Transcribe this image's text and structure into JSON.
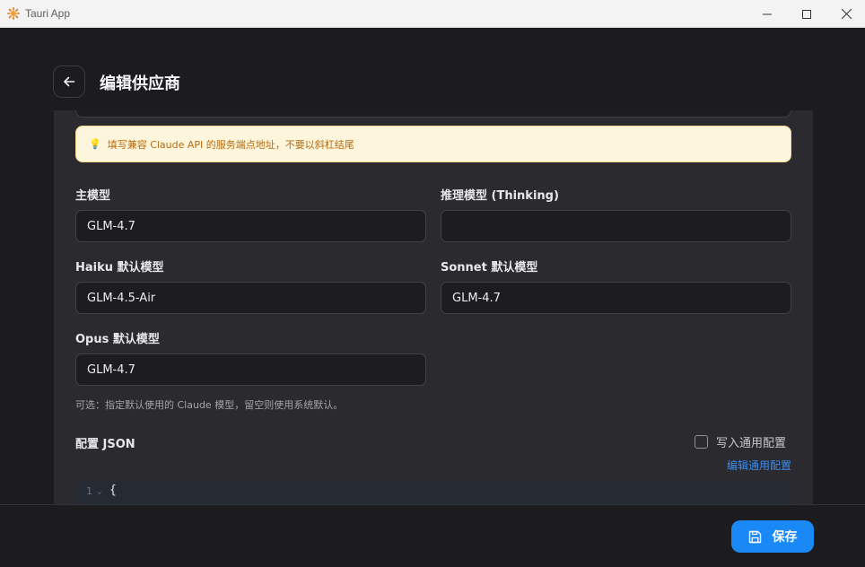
{
  "window": {
    "title": "Tauri App",
    "icon": "tauri-sun-icon"
  },
  "header": {
    "title": "编辑供应商",
    "back_icon": "arrow-left-icon"
  },
  "hint": {
    "icon": "lightbulb-icon",
    "text": "填写兼容 Claude API 的服务端点地址，不要以斜杠结尾"
  },
  "models": {
    "main": {
      "label": "主模型",
      "value": "GLM-4.7"
    },
    "thinking": {
      "label": "推理模型 (Thinking)",
      "value": ""
    },
    "haiku": {
      "label": "Haiku 默认模型",
      "value": "GLM-4.5-Air"
    },
    "sonnet": {
      "label": "Sonnet 默认模型",
      "value": "GLM-4.7"
    },
    "opus": {
      "label": "Opus 默认模型",
      "value": "GLM-4.7"
    },
    "helper": "可选：指定默认使用的 Claude 模型，留空则使用系统默认。"
  },
  "json_config": {
    "label": "配置 JSON",
    "checkbox_label": "写入通用配置",
    "checkbox_checked": false,
    "edit_link": "编辑通用配置",
    "line_number": "1",
    "first_line": "{"
  },
  "footer": {
    "save_label": "保存",
    "save_icon": "save-icon"
  },
  "colors": {
    "accent": "#1a88f5",
    "link": "#3b8cf2",
    "hint_bg": "#fdf6dc",
    "hint_text": "#b86b12",
    "panel_bg": "#2b2b2f",
    "app_bg": "#1c1c1e"
  }
}
